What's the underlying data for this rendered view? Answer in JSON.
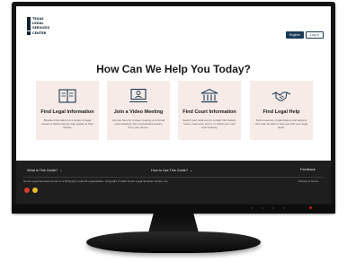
{
  "site": {
    "logo_lines": [
      "TEXAS",
      "LEGAL",
      "SERVICES",
      "CENTER"
    ],
    "language_button": "English",
    "login_button": "Log in"
  },
  "hero": {
    "title": "How Can We Help You Today?"
  },
  "cards": [
    {
      "title": "Find Legal Information",
      "icon": "book-icon",
      "description": "Browse information on a variety of legal issues or follow step-by-step guides to help resolve."
    },
    {
      "title": "Join a Video Meeting",
      "icon": "video-meeting-icon",
      "description": "Are you here for a video meeting or a virtual court hearing? Join a scheduled session from your device."
    },
    {
      "title": "Find Court Information",
      "icon": "courthouse-icon",
      "description": "Search your local court's contact information, hours, resources, forms, or check your next court hearing."
    },
    {
      "title": "Find Legal Help",
      "icon": "handshake-icon",
      "description": "Find resources, organizations and lawyers who may be able to help you with your legal issue."
    }
  ],
  "footer": {
    "link_what": "What is This Guide?",
    "link_how": "How to Use This Guide?",
    "link_feedback": "Feedback",
    "note": "Texas Legal Services Center is a 501(c)(3) nonprofit organization. Copyright © 2022 Texas Legal Services Center, Inc.",
    "right_link": "Privacy & Terms"
  },
  "colors": {
    "navy": "#0f2233",
    "button": "#1b3a57",
    "card_bg": "#f6ebe6",
    "footer_bg": "#1e1e1e"
  }
}
